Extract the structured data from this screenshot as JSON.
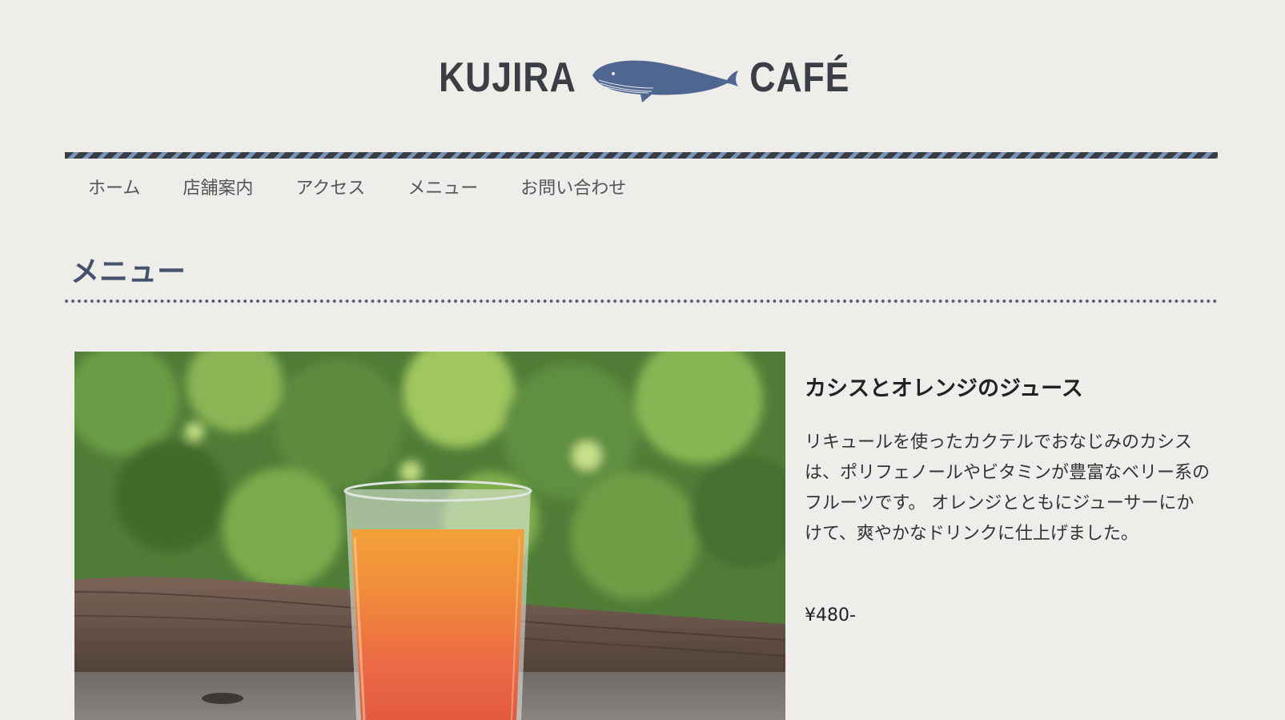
{
  "header": {
    "logo_left": "KUJIRA",
    "logo_right": "CAFÉ",
    "logo_icon": "whale-icon",
    "brand_color": "#4f6690"
  },
  "nav": {
    "items": [
      {
        "label": "ホーム"
      },
      {
        "label": "店舗案内"
      },
      {
        "label": "アクセス"
      },
      {
        "label": "メニュー"
      },
      {
        "label": "お問い合わせ"
      }
    ]
  },
  "main": {
    "section_title": "メニュー",
    "item": {
      "name": "カシスとオレンジのジュース",
      "description": "リキュールを使ったカクテルでおなじみのカシスは、ポリフェノールやビタミンが豊富なベリー系のフルーツです。 オレンジとともにジューサーにかけて、爽やかなドリンクに仕上げました。",
      "price": "¥480-"
    }
  },
  "colors": {
    "background": "#eeedea",
    "heading": "#47526e",
    "stripe_dark": "#3a3d44",
    "stripe_light": "#7895b9"
  }
}
